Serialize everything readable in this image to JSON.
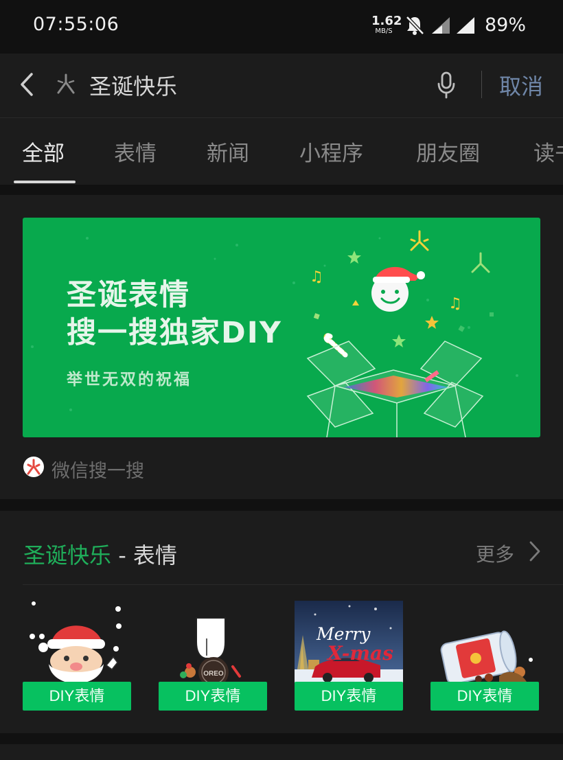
{
  "status_bar": {
    "time": "07:55:06",
    "net_speed_value": "1.62",
    "net_speed_unit": "MB/S",
    "battery": "89%"
  },
  "search": {
    "query": "圣诞快乐",
    "cancel_label": "取消"
  },
  "tabs": [
    {
      "label": "全部",
      "active": true
    },
    {
      "label": "表情",
      "active": false
    },
    {
      "label": "新闻",
      "active": false
    },
    {
      "label": "小程序",
      "active": false
    },
    {
      "label": "朋友圈",
      "active": false
    },
    {
      "label": "读书",
      "active": false
    }
  ],
  "banner": {
    "title_line1": "圣诞表情",
    "title_line2": "搜一搜独家DIY",
    "subtitle": "举世无双的祝福",
    "source": "微信搜一搜"
  },
  "sticker_section": {
    "title_highlight": "圣诞快乐",
    "title_rest": " - 表情",
    "more_label": "更多",
    "items": [
      {
        "label": "DIY表情",
        "icon": "santa-sticker"
      },
      {
        "label": "DIY表情",
        "icon": "oreo-hand-sticker"
      },
      {
        "label": "DIY表情",
        "icon": "merry-xmas-car-sticker",
        "overlay_text_1": "Merry",
        "overlay_text_2": "X-mas"
      },
      {
        "label": "DIY表情",
        "icon": "red-envelope-jar-sticker"
      }
    ]
  },
  "colors": {
    "accent_green": "#07c160",
    "banner_green": "#08a94d",
    "link_blue": "#6f86a8",
    "background": "#111111",
    "card": "#1c1c1c"
  }
}
